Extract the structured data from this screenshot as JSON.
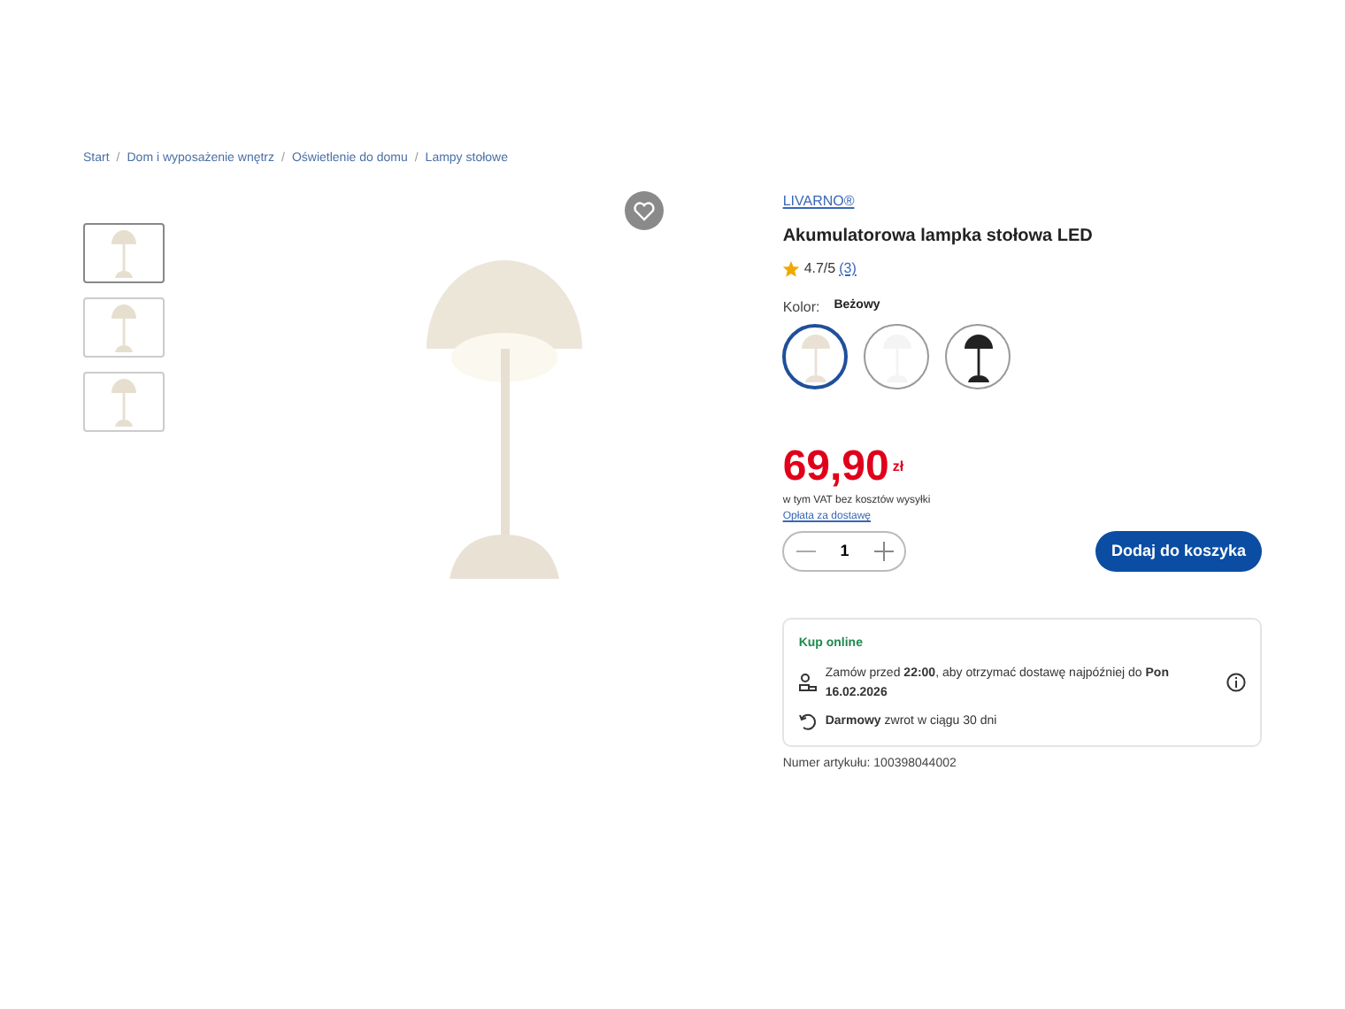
{
  "breadcrumb": [
    {
      "label": "Start",
      "separator": "/"
    },
    {
      "label": "Dom i wyposażenie wnętrz",
      "separator": "/"
    },
    {
      "label": "Oświetlenie do domu",
      "separator": "/"
    },
    {
      "label": "Lampy stołowe"
    }
  ],
  "gallery": {
    "thumbnails": [
      {
        "selected": true
      },
      {
        "selected": false
      },
      {
        "selected": false
      }
    ]
  },
  "product": {
    "brand": "LIVARNO®",
    "title": "Akumulatorowa lampka stołowa LED",
    "rating": "4.7/5",
    "reviews": "(3)",
    "color_label": "Kolor:",
    "color_value": "Beżowy",
    "variants": [
      {
        "selected": true,
        "color": "#e9e2d4"
      },
      {
        "selected": false,
        "color": "#f4f4f4"
      },
      {
        "selected": false,
        "color": "#222222"
      }
    ],
    "price": "69,90",
    "currency": "zł",
    "tax_note": "w tym VAT bez kosztów wysyłki",
    "delivery_link": "Opłata za dostawę",
    "quantity": "1",
    "add_to_cart": "Dodaj do koszyka"
  },
  "delivery": {
    "title": "Kup online",
    "lines": [
      {
        "text": "Zamów przed **22:00**, aby otrzymać dostawę najpóźniej do **Pon 16.02.2026**"
      },
      {
        "text": "**Darmowy** zwrot w ciągu 30 dni"
      }
    ]
  },
  "article_number": "Numer artykułu: 100398044002"
}
